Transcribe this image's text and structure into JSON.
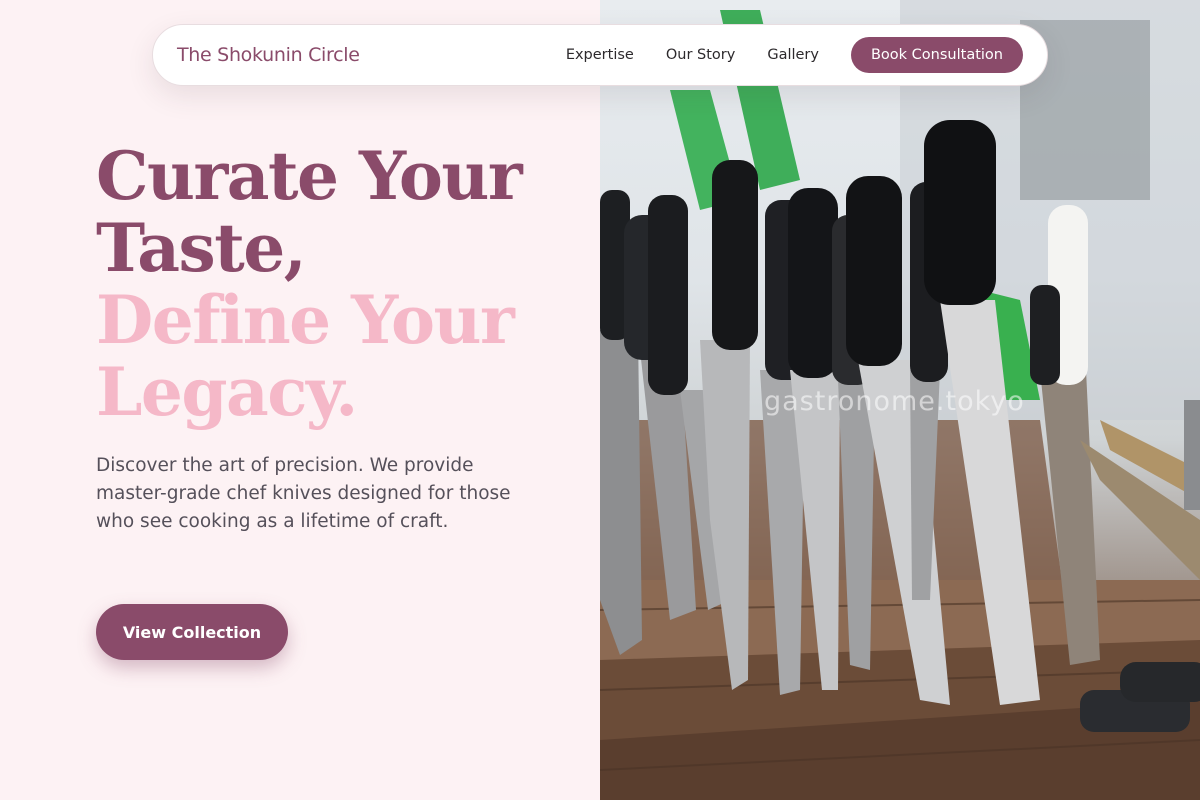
{
  "nav": {
    "brand": "The Shokunin Circle",
    "links": [
      "Expertise",
      "Our Story",
      "Gallery"
    ],
    "cta": "Book Consultation"
  },
  "hero": {
    "headline_line1": "Curate Your",
    "headline_line2": "Taste,",
    "headline_line3": "Define Your",
    "headline_line4": "Legacy.",
    "lede": "Discover the art of precision. We provide master-grade chef knives designed for those who see cooking as a lifetime of craft.",
    "button": "View Collection"
  },
  "image": {
    "watermark": "gastronome.tokyo"
  },
  "colors": {
    "accent": "#8a4b6a",
    "accent_light": "#f5b8c8",
    "background": "#fdf2f4"
  }
}
